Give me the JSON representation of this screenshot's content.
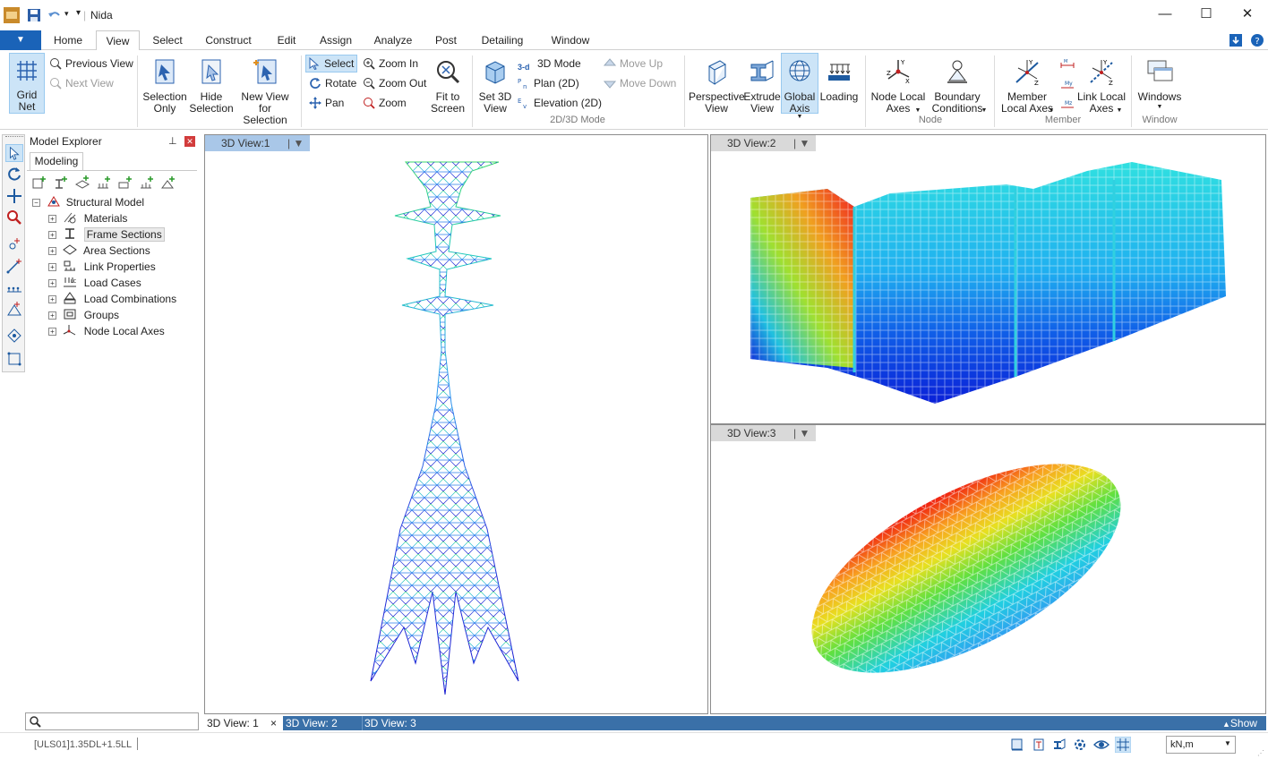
{
  "window": {
    "title": "Nida",
    "minimize": "—",
    "maximize": "☐",
    "close": "✕"
  },
  "menu": {
    "file": "▼",
    "tabs": [
      "Home",
      "View",
      "Select",
      "Construct",
      "Edit",
      "Assign",
      "Analyze",
      "Post",
      "Detailing",
      "Window"
    ],
    "active": "View"
  },
  "ribbon": {
    "grid_net": "Grid Net",
    "previous_view": "Previous View",
    "next_view": "Next View",
    "selection_only": "Selection Only",
    "hide_selection": "Hide Selection",
    "new_view_for_selection": "New View for Selection",
    "select": "Select",
    "rotate": "Rotate",
    "pan": "Pan",
    "zoom_in": "Zoom In",
    "zoom_out": "Zoom Out",
    "zoom": "Zoom",
    "fit_to_screen": "Fit to Screen",
    "set_3d_view": "Set 3D View",
    "mode_3d": "3D Mode",
    "plan_2d": "Plan (2D)",
    "elevation_2d": "Elevation (2D)",
    "move_up": "Move Up",
    "move_down": "Move Down",
    "group_2d3d": "2D/3D Mode",
    "perspective_view": "Perspective View",
    "extrude_view": "Extrude View",
    "global_axis": "Global Axis",
    "loading": "Loading",
    "node_local_axes": "Node Local Axes",
    "boundary_conditions": "Boundary Conditions",
    "group_node": "Node",
    "member_local_axes": "Member Local Axes",
    "link_local_axes": "Link Local Axes",
    "group_member": "Member",
    "windows": "Windows",
    "group_window": "Window"
  },
  "explorer": {
    "title": "Model Explorer",
    "tab": "Modeling",
    "root": "Structural Model",
    "items": [
      "Materials",
      "Frame Sections",
      "Area Sections",
      "Link Properties",
      "Load Cases",
      "Load Combinations",
      "Groups",
      "Node Local Axes"
    ],
    "search_placeholder": ""
  },
  "views": [
    {
      "label": "3D View:1"
    },
    {
      "label": "3D View:2"
    },
    {
      "label": "3D View:3"
    }
  ],
  "bottom_tabs": [
    "3D View: 1",
    "3D View: 2",
    "3D View: 3"
  ],
  "bottom_show": "Show",
  "status": {
    "load_combo": "[ULS01]1.35DL+1.5LL",
    "units": "kN,m"
  },
  "colors": {
    "accent": "#1a63b8",
    "tab_bar": "#3a70a8"
  }
}
